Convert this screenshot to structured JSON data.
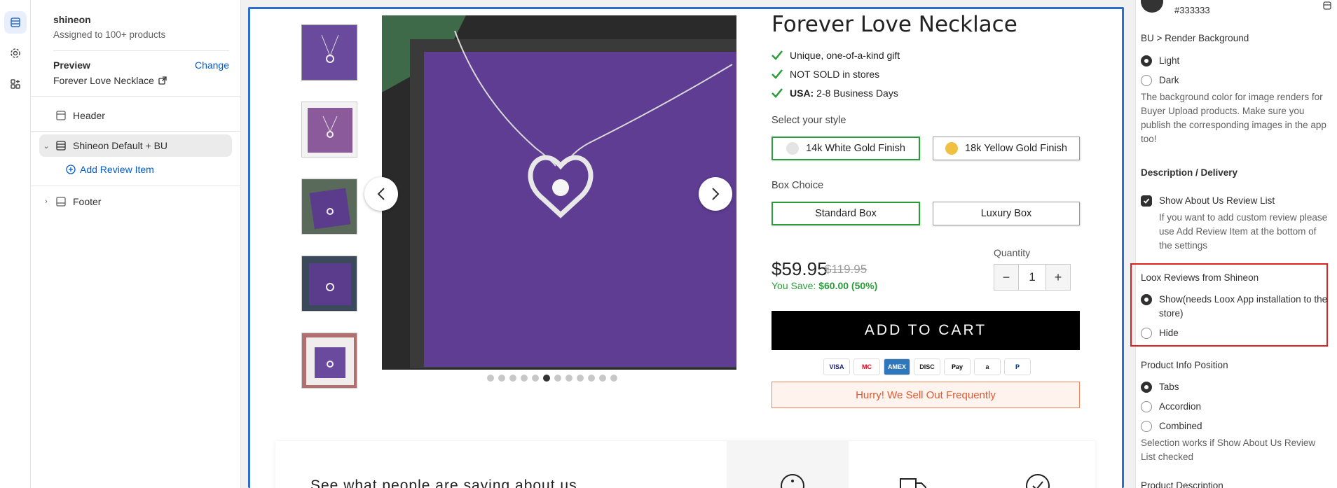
{
  "rail": {
    "items": [
      "sections-icon",
      "settings-icon",
      "apps-icon"
    ]
  },
  "sidebar": {
    "app_name": "shineon",
    "app_sub": "Assigned to 100+ products",
    "preview_label": "Preview",
    "change_label": "Change",
    "preview_value": "Forever Love Necklace",
    "header_label": "Header",
    "section_label": "Shineon Default + BU",
    "add_item_label": "Add Review Item",
    "footer_label": "Footer"
  },
  "product": {
    "title": "Forever Love Necklace",
    "bullets": [
      {
        "text": "Unique, one-of-a-kind gift",
        "bold": ""
      },
      {
        "text": "NOT SOLD in stores",
        "bold": ""
      },
      {
        "text": " 2-8 Business Days",
        "bold": "USA:"
      }
    ],
    "style_label": "Select your style",
    "styles": [
      "14k White Gold Finish",
      "18k Yellow Gold Finish"
    ],
    "style_colors": [
      "#e4e4e4",
      "#f0c040"
    ],
    "box_label": "Box Choice",
    "boxes": [
      "Standard Box",
      "Luxury Box"
    ],
    "price": "$59.95",
    "compare_price": "$119.95",
    "save_prefix": "You Save: ",
    "save_amount": "$60.00 (50%)",
    "qty_label": "Quantity",
    "qty_value": "1",
    "add_to_cart": "ADD TO CART",
    "payments": [
      "VISA",
      "MC",
      "AMEX",
      "DISC",
      "Pay",
      "a",
      "P"
    ],
    "hurry": "Hurry! We Sell Out Frequently",
    "reviews_heading": "See what people are saying about us",
    "dots_count": 12,
    "dots_active": 5
  },
  "right": {
    "color_hex": "#333333",
    "render_bg_label": "BU > Render Background",
    "render_bg_options": [
      "Light",
      "Dark"
    ],
    "render_bg_help": "The background color for image renders for Buyer Upload products. Make sure you publish the corresponding images in the app too!",
    "desc_heading": "Description / Delivery",
    "show_about_label": "Show About Us Review List",
    "show_about_help": "If you want to add custom review please use Add Review Item at the bottom of the settings",
    "loox_label": "Loox Reviews from Shineon",
    "loox_options": [
      "Show(needs Loox App installation to the store)",
      "Hide"
    ],
    "info_pos_label": "Product Info Position",
    "info_pos_options": [
      "Tabs",
      "Accordion",
      "Combined"
    ],
    "info_pos_help": "Selection works if Show About Us Review List checked",
    "product_desc_label": "Product Description"
  }
}
